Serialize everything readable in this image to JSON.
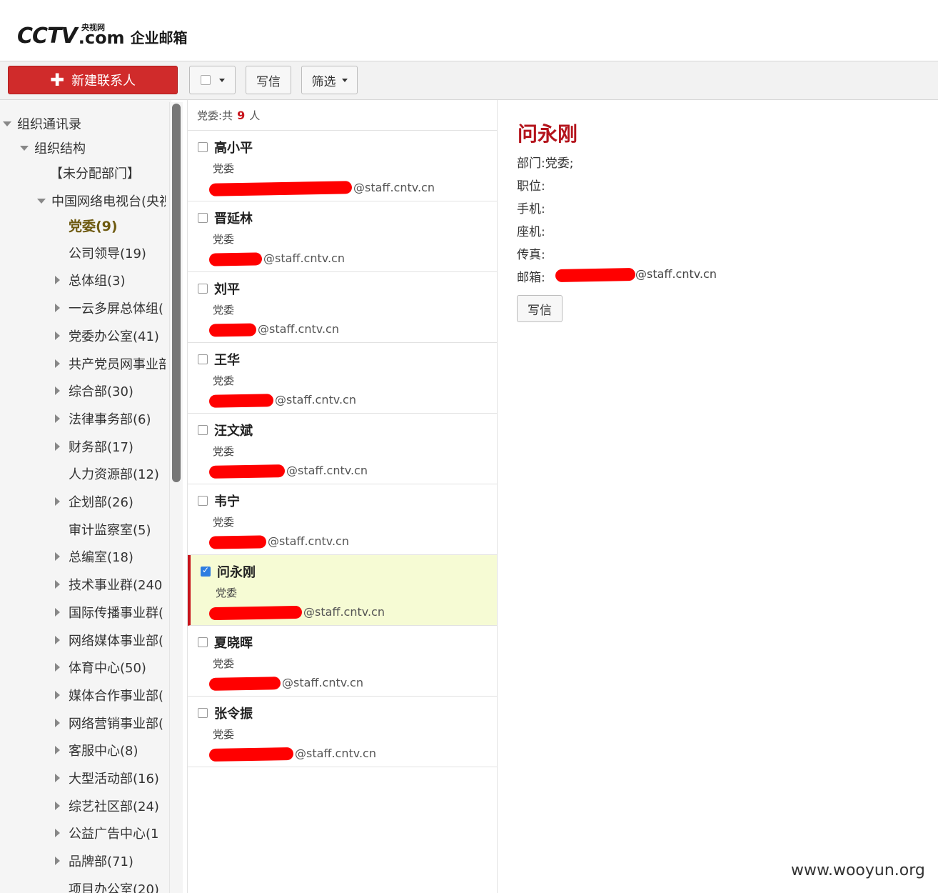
{
  "header": {
    "logo_cctv": "CCTV",
    "logo_com": ".com",
    "logo_cn": "央视网",
    "logo_mail": "企业邮箱"
  },
  "toolbar": {
    "new_contact": "新建联系人",
    "write": "写信",
    "filter": "筛选"
  },
  "sidebar": {
    "root": "组织通讯录",
    "structure": "组织结构",
    "unassigned": "【未分配部门】",
    "org": "中国网络电视台(央视网)",
    "items": [
      {
        "label": "党委(9)",
        "arrow": false,
        "active": true
      },
      {
        "label": "公司领导(19)",
        "arrow": false
      },
      {
        "label": "总体组(3)",
        "arrow": true
      },
      {
        "label": "一云多屏总体组(",
        "arrow": true
      },
      {
        "label": "党委办公室(41)",
        "arrow": true
      },
      {
        "label": "共产党员网事业部",
        "arrow": true
      },
      {
        "label": "综合部(30)",
        "arrow": true
      },
      {
        "label": "法律事务部(6)",
        "arrow": true
      },
      {
        "label": "财务部(17)",
        "arrow": true
      },
      {
        "label": "人力资源部(12)",
        "arrow": false
      },
      {
        "label": "企划部(26)",
        "arrow": true
      },
      {
        "label": "审计监察室(5)",
        "arrow": false
      },
      {
        "label": "总编室(18)",
        "arrow": true
      },
      {
        "label": "技术事业群(240",
        "arrow": true
      },
      {
        "label": "国际传播事业群(",
        "arrow": true
      },
      {
        "label": "网络媒体事业部(",
        "arrow": true
      },
      {
        "label": "体育中心(50)",
        "arrow": true
      },
      {
        "label": "媒体合作事业部(",
        "arrow": true
      },
      {
        "label": "网络营销事业部(",
        "arrow": true
      },
      {
        "label": "客服中心(8)",
        "arrow": true
      },
      {
        "label": "大型活动部(16)",
        "arrow": true
      },
      {
        "label": "综艺社区部(24)",
        "arrow": true
      },
      {
        "label": "公益广告中心(1",
        "arrow": true
      },
      {
        "label": "品牌部(71)",
        "arrow": true
      },
      {
        "label": "项目办公室(20)",
        "arrow": false
      }
    ]
  },
  "list": {
    "head_prefix": "党委:共",
    "count": "9",
    "head_suffix": "人",
    "contacts": [
      {
        "name": "高小平",
        "dept": "党委",
        "email": "@staff.cntv.cn",
        "selected": false
      },
      {
        "name": "晋延林",
        "dept": "党委",
        "email": "@staff.cntv.cn",
        "selected": false
      },
      {
        "name": "刘平",
        "dept": "党委",
        "email": "@staff.cntv.cn",
        "selected": false
      },
      {
        "name": "王华",
        "dept": "党委",
        "email": "@staff.cntv.cn",
        "selected": false
      },
      {
        "name": "汪文斌",
        "dept": "党委",
        "email": "@staff.cntv.cn",
        "selected": false
      },
      {
        "name": "韦宁",
        "dept": "党委",
        "email": "@staff.cntv.cn",
        "selected": false
      },
      {
        "name": "问永刚",
        "dept": "党委",
        "email": "@staff.cntv.cn",
        "selected": true
      },
      {
        "name": "夏晓晖",
        "dept": "党委",
        "email": "@staff.cntv.cn",
        "selected": false
      },
      {
        "name": "张令振",
        "dept": "党委",
        "email": "@staff.cntv.cn",
        "selected": false
      }
    ]
  },
  "detail": {
    "name": "问永刚",
    "dept_label": "部门:党委;",
    "position_label": "职位:",
    "mobile_label": "手机:",
    "phone_label": "座机:",
    "fax_label": "传真:",
    "email_label": "邮箱:",
    "email": "@staff.cntv.cn",
    "write": "写信"
  },
  "watermark": "www.wooyun.org"
}
